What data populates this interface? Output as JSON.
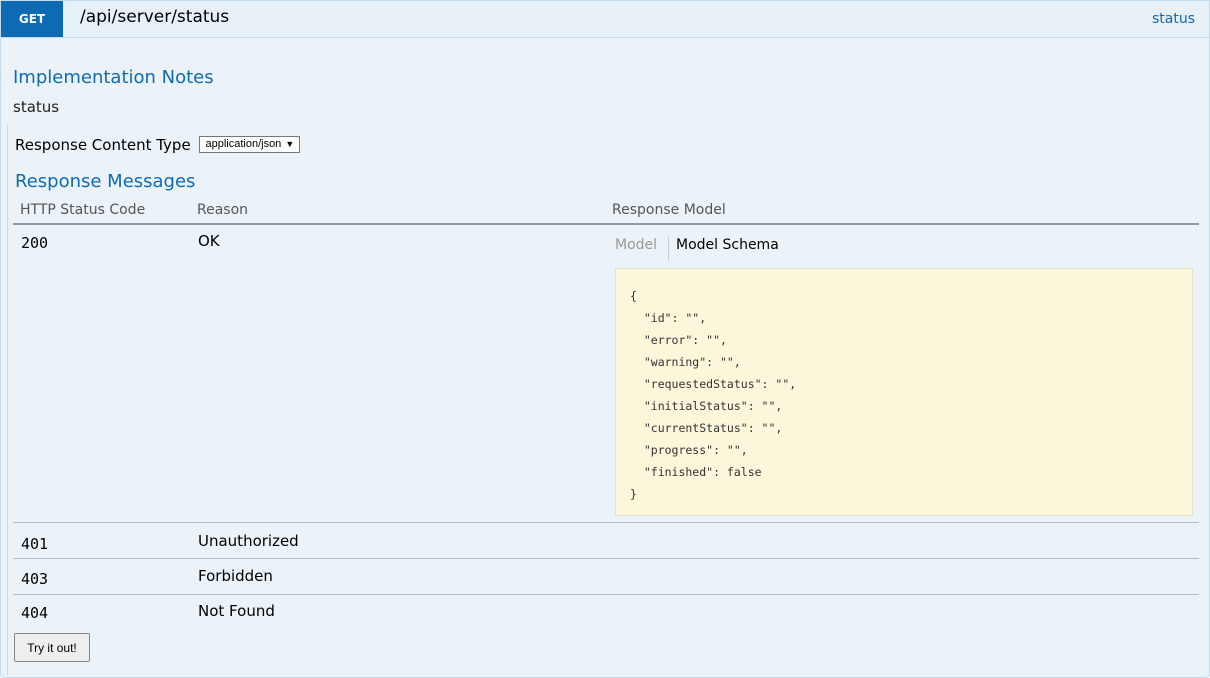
{
  "heading": {
    "method": "GET",
    "path": "/api/server/status",
    "link": "status"
  },
  "notes": {
    "title": "Implementation Notes",
    "text": "status"
  },
  "response_content_type": {
    "label": "Response Content Type",
    "selected": "application/json"
  },
  "response_messages": {
    "title": "Response Messages",
    "columns": [
      "HTTP Status Code",
      "Reason",
      "Response Model"
    ],
    "rows": [
      {
        "code": "200",
        "reason": "OK"
      },
      {
        "code": "401",
        "reason": "Unauthorized"
      },
      {
        "code": "403",
        "reason": "Forbidden"
      },
      {
        "code": "404",
        "reason": "Not Found"
      }
    ]
  },
  "model_tabs": {
    "model": "Model",
    "schema": "Model Schema"
  },
  "schema_text": "{\n  \"id\": \"\",\n  \"error\": \"\",\n  \"warning\": \"\",\n  \"requestedStatus\": \"\",\n  \"initialStatus\": \"\",\n  \"currentStatus\": \"\",\n  \"progress\": \"\",\n  \"finished\": false\n}",
  "try_button": "Try it out!",
  "colors": {
    "accent": "#0f6ab4",
    "panel_bg": "#ebf3f9",
    "schema_bg": "#fcf6db"
  }
}
